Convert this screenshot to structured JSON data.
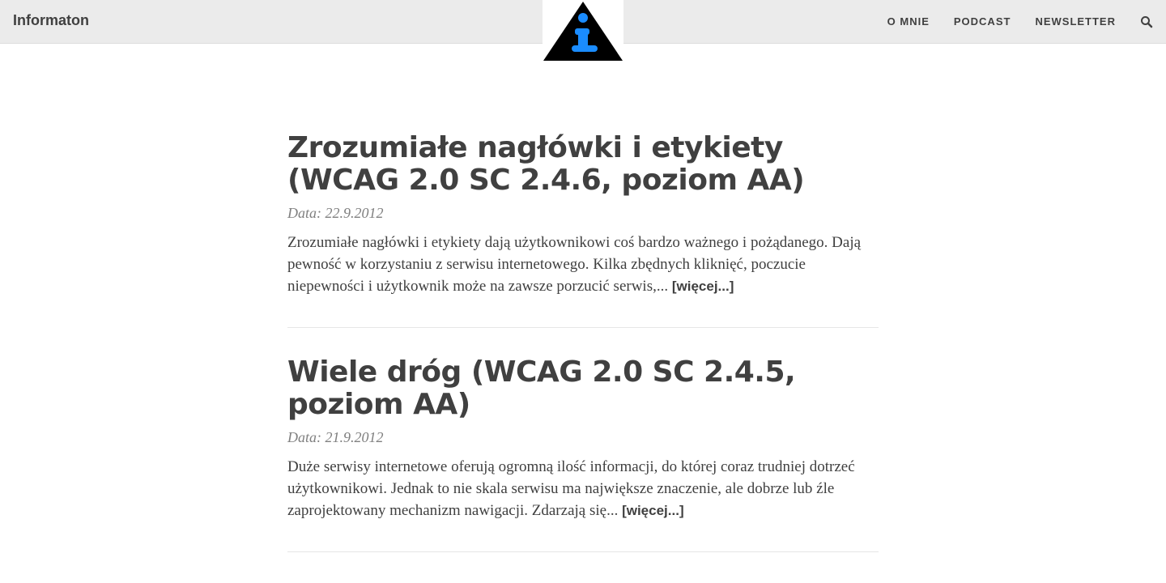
{
  "header": {
    "brand": "Informaton",
    "nav": [
      {
        "label": "O MNIE"
      },
      {
        "label": "PODCAST"
      },
      {
        "label": "NEWSLETTER"
      }
    ],
    "search_icon": "search-icon",
    "logo_icon": "info-triangle-icon",
    "logo_colors": {
      "triangle": "#000000",
      "letter": "#1a8cff"
    }
  },
  "posts": [
    {
      "title": "Zrozumiałe nagłówki i etykiety (WCAG 2.0 SC 2.4.6, poziom AA)",
      "meta": "Data: 22.9.2012",
      "excerpt": "Zrozumiałe nagłówki i etykiety dają użytkownikowi coś bardzo ważnego i pożądanego. Dają pewność w korzystaniu z serwisu internetowego. Kilka zbędnych kliknięć, poczucie niepewności i użytkownik może na zawsze porzucić serwis,...",
      "more": "[więcej...]"
    },
    {
      "title": "Wiele dróg (WCAG 2.0 SC 2.4.5, poziom AA)",
      "meta": "Data: 21.9.2012",
      "excerpt": "Duże serwisy internetowe oferują ogromną ilość informacji, do której coraz trudniej dotrzeć użytkownikowi. Jednak to nie skala serwisu ma największe znaczenie, ale dobrze lub źle zaprojektowany mechanizm nawigacji. Zdarzają się...",
      "more": "[więcej...]"
    }
  ]
}
